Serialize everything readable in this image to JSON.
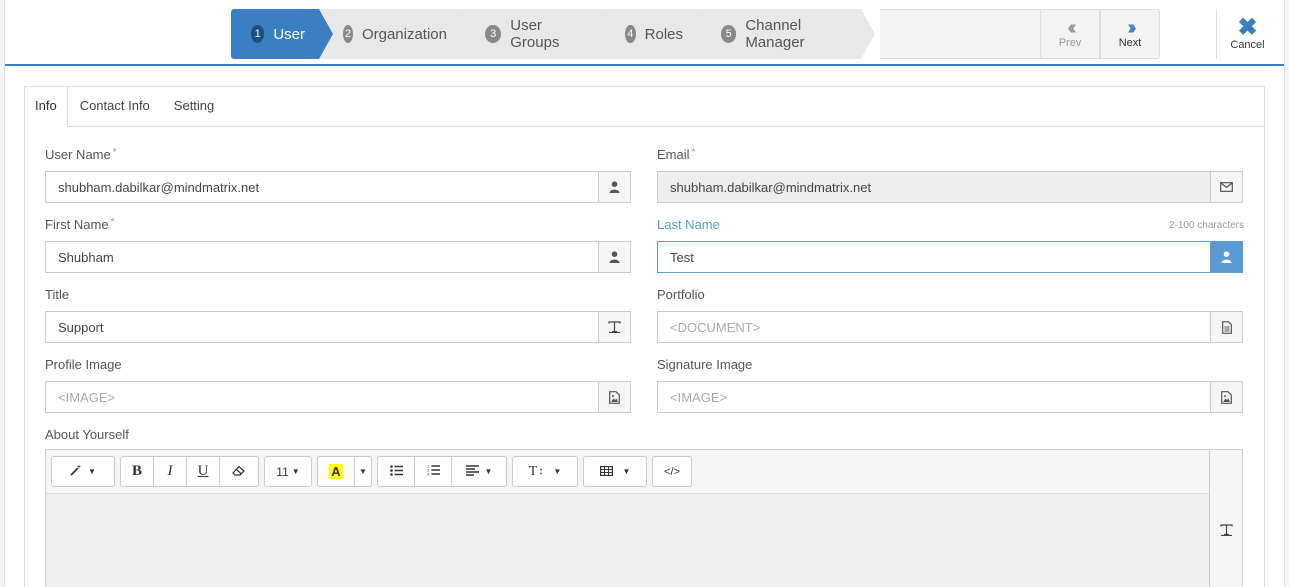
{
  "wizard": {
    "steps": [
      {
        "num": "1",
        "label": "User"
      },
      {
        "num": "2",
        "label": "Organization"
      },
      {
        "num": "3",
        "label": "User Groups"
      },
      {
        "num": "4",
        "label": "Roles"
      },
      {
        "num": "5",
        "label": "Channel Manager"
      }
    ],
    "prev_label": "Prev",
    "next_label": "Next",
    "cancel_label": "Cancel"
  },
  "tabs": [
    "Info",
    "Contact Info",
    "Setting"
  ],
  "form": {
    "user_name": {
      "label": "User Name",
      "required": "*",
      "value": "shubham.dabilkar@mindmatrix.net",
      "icon": "user-icon"
    },
    "email": {
      "label": "Email",
      "required": "*",
      "value": "shubham.dabilkar@mindmatrix.net",
      "icon": "envelope-icon"
    },
    "first_name": {
      "label": "First Name",
      "required": "*",
      "value": "Shubham",
      "icon": "user-icon"
    },
    "last_name": {
      "label": "Last Name",
      "hint": "2-100 characters",
      "value": "Test",
      "icon": "user-icon"
    },
    "title": {
      "label": "Title",
      "value": "Support",
      "icon": "text-icon"
    },
    "portfolio": {
      "label": "Portfolio",
      "placeholder": "<DOCUMENT>",
      "icon": "document-icon"
    },
    "profile_image": {
      "label": "Profile Image",
      "placeholder": "<IMAGE>",
      "icon": "image-icon"
    },
    "signature_image": {
      "label": "Signature Image",
      "placeholder": "<IMAGE>",
      "icon": "image-icon"
    },
    "about": {
      "label": "About Yourself"
    }
  },
  "editor": {
    "font_size": "11",
    "bold": "B",
    "italic": "I",
    "underline": "U",
    "highlight": "A",
    "text_style": "T",
    "code": "</>"
  },
  "colors": {
    "accent": "#3a7fc1",
    "focus": "#5b9bd5"
  }
}
